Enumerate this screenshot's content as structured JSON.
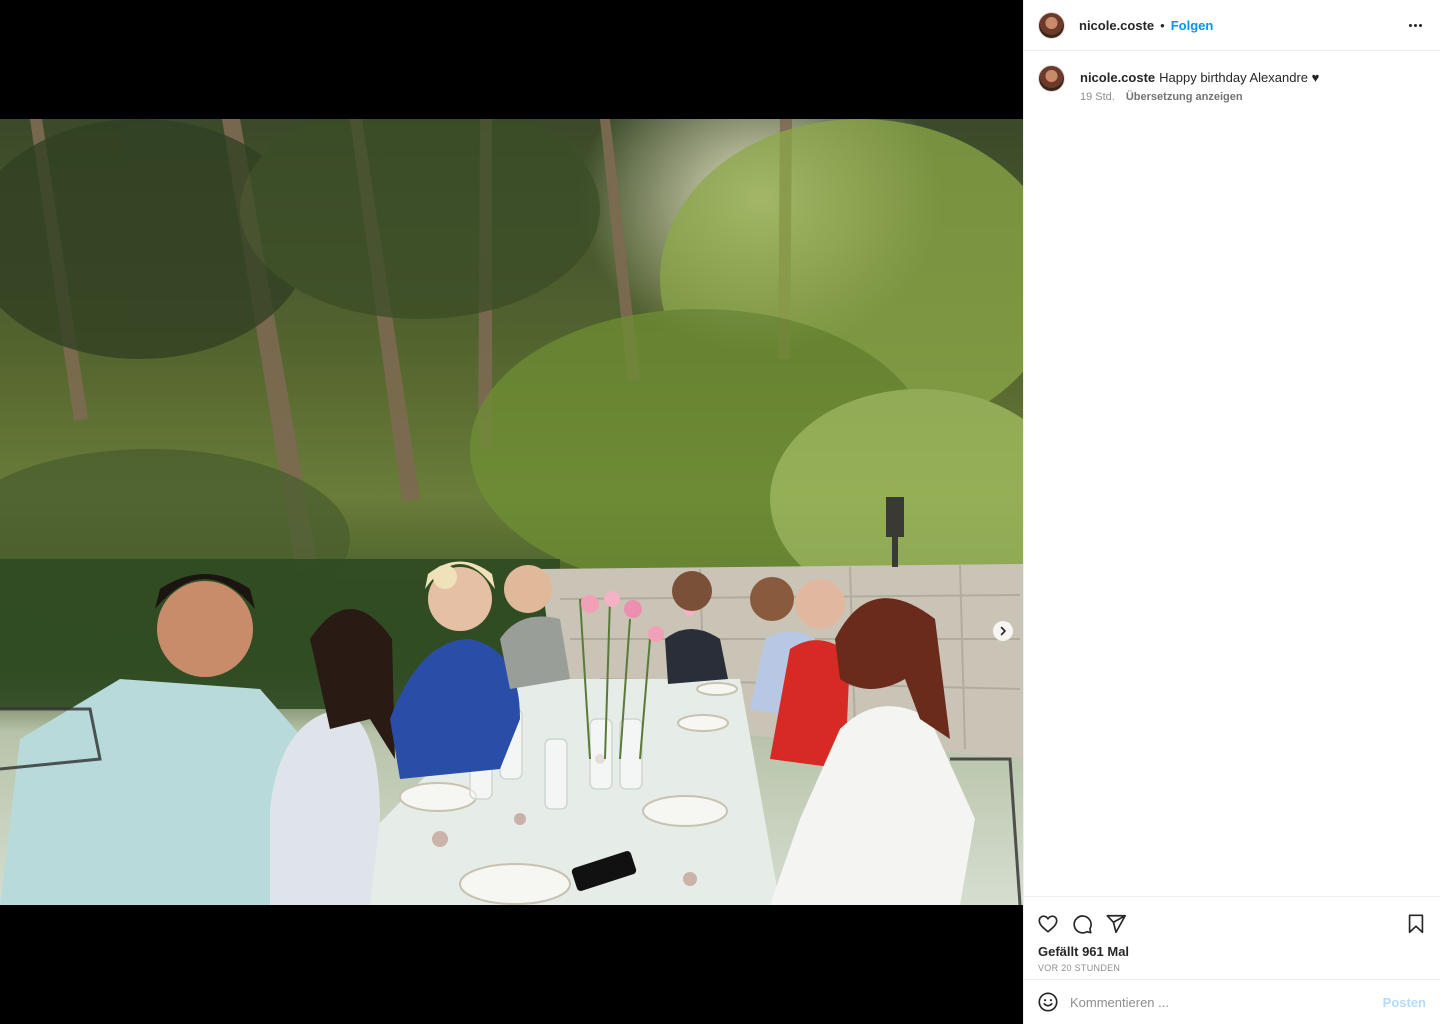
{
  "post": {
    "image_alt": "Group dinner at an outdoor table in a garden",
    "next_icon": "chevron-right-icon"
  },
  "header": {
    "username": "nicole.coste",
    "separator": "•",
    "follow_label": "Folgen",
    "more_icon": "more-horizontal-icon"
  },
  "caption": {
    "username": "nicole.coste",
    "text": "Happy birthday Alexandre ♥",
    "time_ago": "19 Std.",
    "translate_label": "Übersetzung anzeigen"
  },
  "actions": {
    "like_icon": "heart-icon",
    "comment_icon": "comment-icon",
    "share_icon": "send-icon",
    "save_icon": "bookmark-icon",
    "likes_text": "Gefällt 961 Mal",
    "timestamp": "VOR 20 STUNDEN"
  },
  "comment": {
    "emoji_icon": "emoji-icon",
    "placeholder": "Kommentieren ...",
    "post_label": "Posten"
  },
  "colors": {
    "accent": "#0095f6",
    "post_disabled": "#b3dbff",
    "text": "#262626",
    "muted": "#8e8e8e"
  }
}
